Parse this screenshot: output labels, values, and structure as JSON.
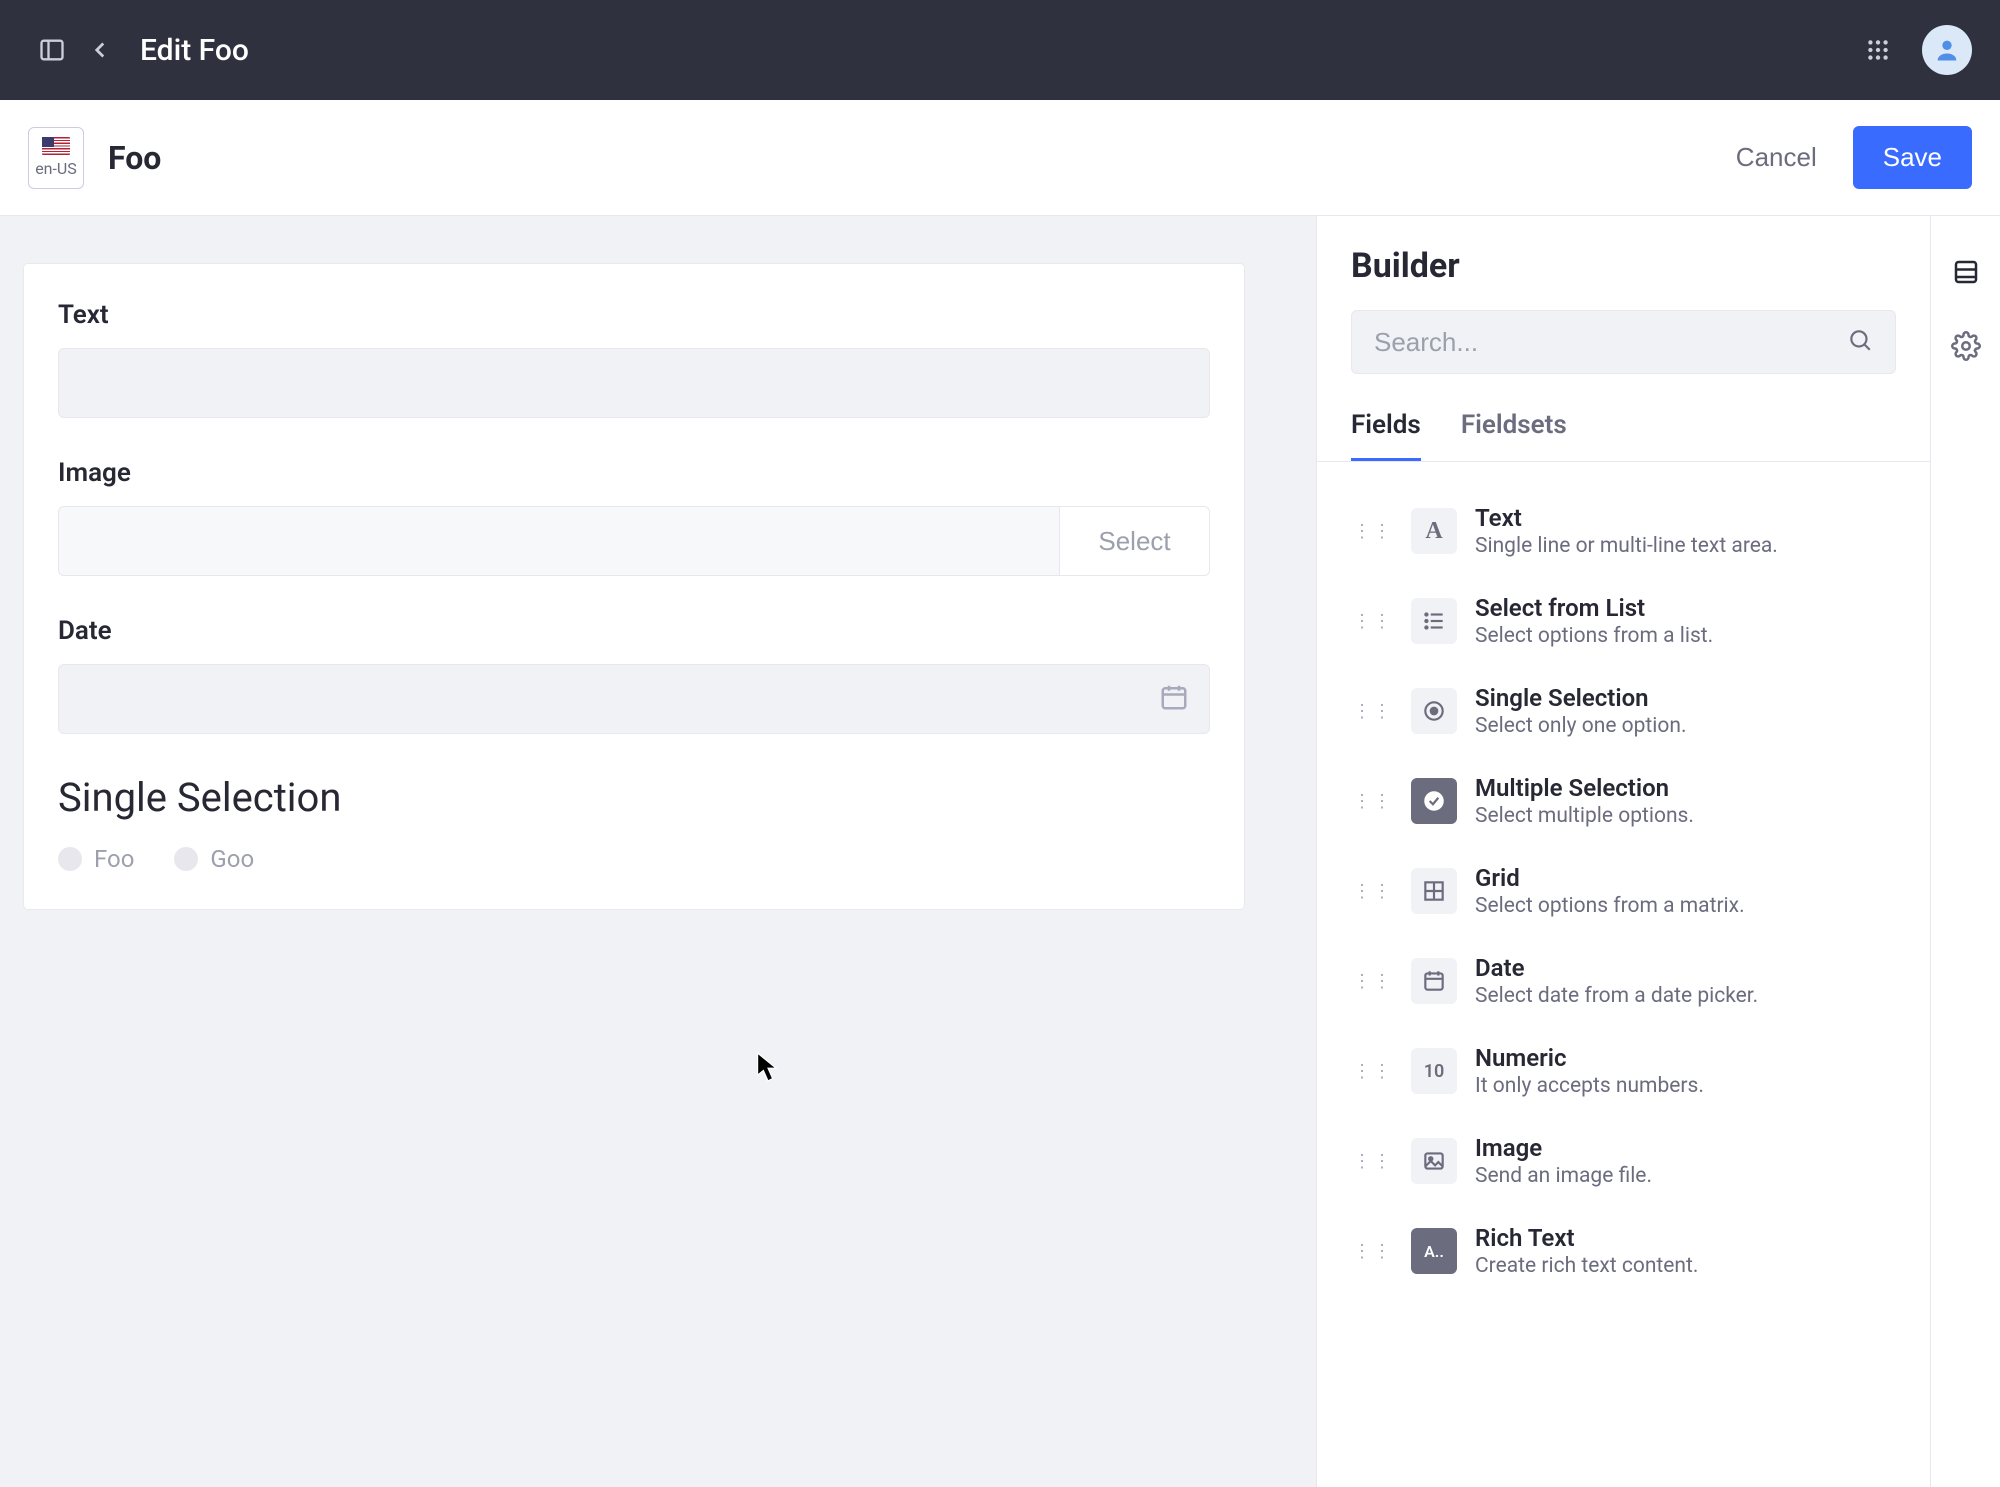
{
  "topbar": {
    "title": "Edit Foo"
  },
  "subheader": {
    "locale": "en-US",
    "page_title": "Foo",
    "cancel_label": "Cancel",
    "save_label": "Save"
  },
  "form": {
    "text_label": "Text",
    "image_label": "Image",
    "image_select_label": "Select",
    "date_label": "Date",
    "single_selection_heading": "Single Selection",
    "radio_options": [
      "Foo",
      "Goo"
    ]
  },
  "builder": {
    "title": "Builder",
    "search_placeholder": "Search...",
    "tabs": {
      "fields": "Fields",
      "fieldsets": "Fieldsets"
    },
    "field_types": [
      {
        "name": "Text",
        "desc": "Single line or multi-line text area.",
        "icon": "A"
      },
      {
        "name": "Select from List",
        "desc": "Select options from a list.",
        "icon": "list"
      },
      {
        "name": "Single Selection",
        "desc": "Select only one option.",
        "icon": "radio"
      },
      {
        "name": "Multiple Selection",
        "desc": "Select multiple options.",
        "icon": "check-dark"
      },
      {
        "name": "Grid",
        "desc": "Select options from a matrix.",
        "icon": "grid"
      },
      {
        "name": "Date",
        "desc": "Select date from a date picker.",
        "icon": "calendar"
      },
      {
        "name": "Numeric",
        "desc": "It only accepts numbers.",
        "icon": "10"
      },
      {
        "name": "Image",
        "desc": "Send an image file.",
        "icon": "image"
      },
      {
        "name": "Rich Text",
        "desc": "Create rich text content.",
        "icon": "richtext-dark"
      }
    ]
  }
}
